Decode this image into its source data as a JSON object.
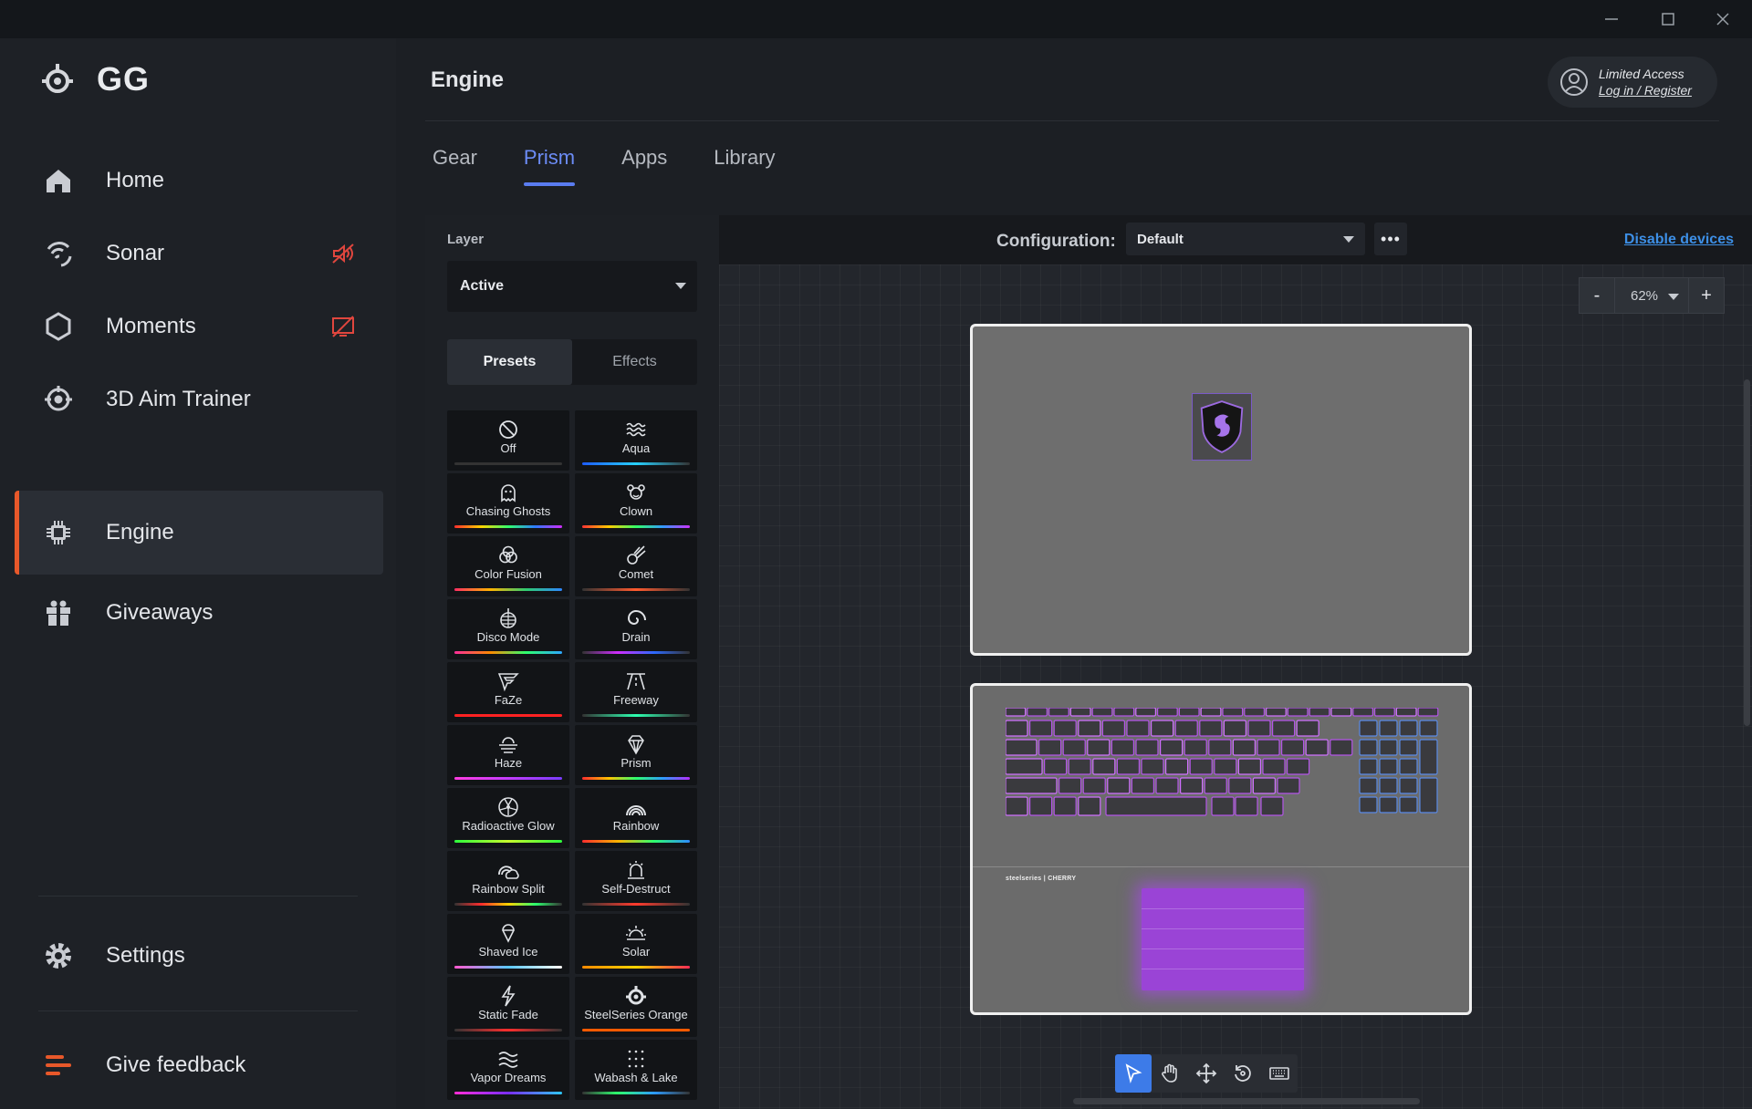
{
  "app": {
    "name": "GG"
  },
  "sidebar": {
    "items": [
      {
        "label": "Home",
        "icon": "home-icon"
      },
      {
        "label": "Sonar",
        "icon": "sonar-icon",
        "badge": "speaker-muted-icon"
      },
      {
        "label": "Moments",
        "icon": "hexagon-icon",
        "badge": "screen-off-icon"
      },
      {
        "label": "3D Aim Trainer",
        "icon": "crosshair-icon"
      },
      {
        "label": "Engine",
        "icon": "chip-icon",
        "active": true
      },
      {
        "label": "Giveaways",
        "icon": "gift-icon"
      }
    ],
    "settings_label": "Settings",
    "feedback_label": "Give feedback",
    "accent_color": "#e8582a"
  },
  "header": {
    "title": "Engine",
    "account_status": "Limited Access",
    "account_link": "Log in / Register"
  },
  "tabs": [
    {
      "label": "Gear"
    },
    {
      "label": "Prism",
      "active": true
    },
    {
      "label": "Apps"
    },
    {
      "label": "Library"
    }
  ],
  "layer": {
    "label": "Layer",
    "value": "Active",
    "segments": [
      "Presets",
      "Effects"
    ],
    "selected_segment": "Presets"
  },
  "presets": [
    "Off",
    "Aqua",
    "Chasing Ghosts",
    "Clown",
    "Color Fusion",
    "Comet",
    "Disco Mode",
    "Drain",
    "FaZe",
    "Freeway",
    "Haze",
    "Prism",
    "Radioactive Glow",
    "Rainbow",
    "Rainbow Split",
    "Self-Destruct",
    "Shaved Ice",
    "Solar",
    "Static Fade",
    "SteelSeries Orange",
    "Vapor Dreams",
    "Wabash & Lake"
  ],
  "configuration": {
    "label": "Configuration:",
    "value": "Default",
    "more_label": "•••",
    "disable_link": "Disable devices",
    "link_color": "#3d8fe6"
  },
  "zoom": {
    "minus": "-",
    "value": "62%",
    "plus": "+"
  },
  "device": {
    "brand_text": "steelseries | CHERRY",
    "touchpad_color": "#9a44d6",
    "key_glow_color": "#b455e8"
  },
  "tools": [
    "select-tool-icon",
    "hand-tool-icon",
    "move-tool-icon",
    "rotate-tool-icon",
    "keyboard-tool-icon"
  ]
}
